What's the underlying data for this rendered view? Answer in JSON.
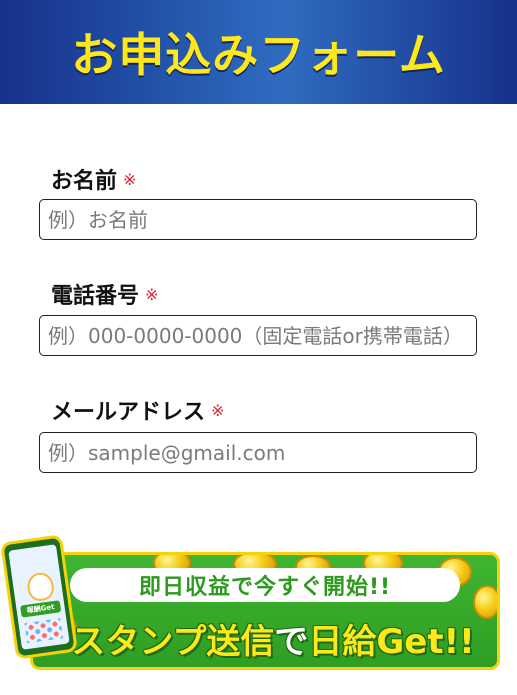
{
  "header": {
    "title": "お申込みフォーム"
  },
  "form": {
    "required_mark": "※",
    "fields": [
      {
        "label": "お名前",
        "placeholder": "例）お名前"
      },
      {
        "label": "電話番号",
        "placeholder": "例）000-0000-0000（固定電話or携帯電話）"
      },
      {
        "label": "メールアドレス",
        "placeholder": "例）sample@gmail.com"
      }
    ]
  },
  "banner": {
    "top_text": "即日収益で今すぐ開始!!",
    "main_part1": "スタンプ送信",
    "main_part2": "で",
    "main_part3": "日給Get!!",
    "phone_chip": "報酬Get"
  },
  "colors": {
    "header_blue": "#1f4aa0",
    "title_yellow": "#ffe81a",
    "required_red": "#e0202a",
    "banner_green": "#3fb531"
  }
}
